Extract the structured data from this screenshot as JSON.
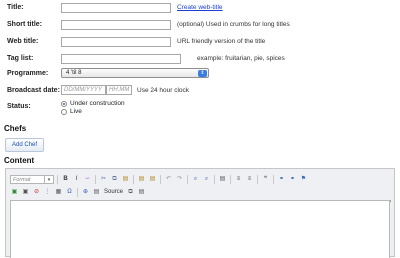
{
  "form": {
    "title_label": "Title:",
    "title_link": "Create web-title",
    "short_title_label": "Short title:",
    "short_title_hint": "(optional) Used in crumbs for long titles",
    "web_title_label": "Web title:",
    "web_title_hint": "URL friendly version of the title",
    "tag_list_label": "Tag list:",
    "tag_list_hint": "example: fruitarian, pie, spices",
    "programme_label": "Programme:",
    "programme_value": "4 'til 8",
    "broadcast_label": "Broadcast date:",
    "date_placeholder": "DD/MM/YYYY",
    "time_placeholder": "HH:MM",
    "time_hint": "Use 24 hour clock",
    "status_label": "Status:",
    "status_options": [
      "Under construction",
      "Live"
    ],
    "status_selected": "Under construction"
  },
  "chefs": {
    "heading": "Chefs",
    "add_button": "Add Chef"
  },
  "content": {
    "heading": "Content",
    "format_placeholder": "Format",
    "source_label": "Source"
  },
  "icons": {
    "bold": "B",
    "italic": "I",
    "strike": "S",
    "link": "link-icon",
    "unlink": "unlink-icon",
    "anchor": "anchor-icon",
    "image": "image-icon",
    "flash": "flash-icon",
    "table": "table-icon",
    "hr": "horizontal-rule-icon",
    "special_char": "omega-icon",
    "undo": "undo-icon",
    "redo": "redo-icon",
    "find": "find-icon",
    "replace": "replace-icon",
    "ordered_list": "ordered-list-icon",
    "unordered_list": "unordered-list-icon",
    "blockquote": "blockquote-icon"
  },
  "colors": {
    "link": "#1a3fcf",
    "select_arrow": "#3b7de0",
    "editor_bg": "#eef0f3"
  }
}
